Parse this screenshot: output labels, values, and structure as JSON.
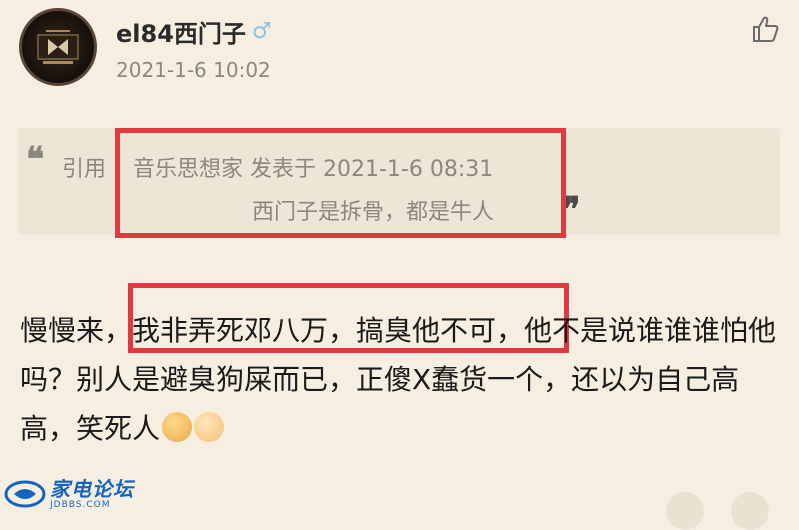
{
  "post": {
    "username": "el84西门子",
    "gender_symbol": "♂",
    "timestamp": "2021-1-6 10:02"
  },
  "quote": {
    "prefix": "引用",
    "meta": "音乐思想家 发表于 2021-1-6 08:31",
    "text": "西门子是拆骨，都是牛人",
    "open_mark": "❝",
    "close_mark": "❞"
  },
  "body": {
    "before": "慢慢来，",
    "highlight": "我非弄死邓八万，搞臭他不可，",
    "after": "他不是说谁谁谁怕他吗？别人是避臭狗屎而已，正傻X蠢货一个，还以为自己高高，笑死人"
  },
  "watermark": {
    "main": "家电论坛",
    "sub": "JDBBS.COM"
  },
  "icons": {
    "like": "thumbs-up-icon",
    "comment": "comment-icon",
    "more": "more-icon"
  },
  "colors": {
    "highlight_box": "#e2383f",
    "background": "#f6efe1",
    "quote_background": "#ede6d7"
  }
}
